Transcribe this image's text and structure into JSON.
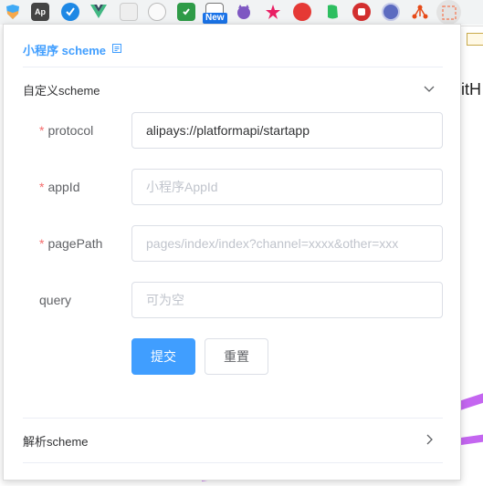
{
  "popup": {
    "title": "小程序 scheme"
  },
  "section_custom": {
    "header": "自定义scheme",
    "fields": {
      "protocol": {
        "label": "protocol",
        "required_mark": "*",
        "value": "alipays://platformapi/startapp",
        "placeholder": ""
      },
      "appid": {
        "label": "appId",
        "required_mark": "*",
        "value": "",
        "placeholder": "小程序AppId"
      },
      "pagepath": {
        "label": "pagePath",
        "required_mark": "*",
        "value": "",
        "placeholder": "pages/index/index?channel=xxxx&other=xxx"
      },
      "query": {
        "label": "query",
        "value": "",
        "placeholder": "可为空"
      }
    },
    "submit_label": "提交",
    "reset_label": "重置"
  },
  "section_parse": {
    "header": "解析scheme"
  },
  "extensions": {
    "new_badge": "New"
  },
  "background_page": {
    "partial_text": "itH"
  },
  "colors": {
    "accent": "#409eff",
    "required": "#f56c6c",
    "border": "#dcdfe6",
    "placeholder": "#c0c4cc"
  }
}
